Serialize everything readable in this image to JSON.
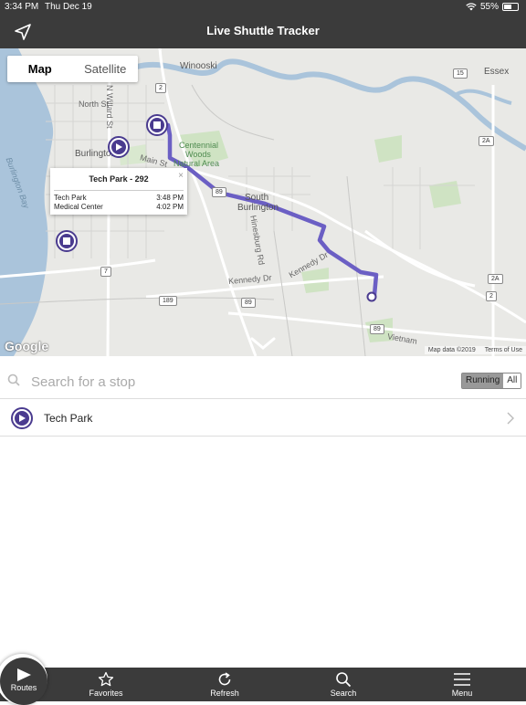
{
  "status": {
    "time": "3:34 PM",
    "date": "Thu Dec 19",
    "battery": "55%",
    "battery_level": 0.55
  },
  "header": {
    "title": "Live Shuttle Tracker",
    "left_icon": "location-arrow-icon"
  },
  "map": {
    "toggle": {
      "map_label": "Map",
      "satellite_label": "Satellite",
      "selected": "Map"
    },
    "labels": {
      "winooski": "Winooski",
      "essex": "Essex",
      "burlington": "Burlington",
      "burlington_bay": "Burlington Bay",
      "centennial": "Centennial",
      "woods": "Woods",
      "natural_area": "Natural Area",
      "south": "South",
      "burlington2": "Burlington",
      "n_willard": "N Willard St",
      "north_st": "North St",
      "main_st": "Main St",
      "kennedy_dr": "Kennedy Dr",
      "kennedy_dr2": "Kennedy Dr",
      "hinesburg": "Hinesburg Rd",
      "vietnam": "Vietnam"
    },
    "shields": {
      "r2": "2",
      "r15": "15",
      "r2a": "2A",
      "r2a_b": "2A",
      "r2_b": "2",
      "r7": "7",
      "r189": "189",
      "r89": "89",
      "r89_b": "89",
      "r89_c": "89"
    },
    "popup": {
      "title": "Tech Park - 292",
      "close": "×",
      "stops": [
        {
          "name": "Tech Park",
          "time": "3:48 PM"
        },
        {
          "name": "Medical Center",
          "time": "4:02 PM"
        }
      ]
    },
    "google": "Google",
    "attribution": "Map data ©2019",
    "terms": "Terms of Use",
    "route_color": "#6b5fc4",
    "marker_color": "#4a3b8f"
  },
  "search": {
    "placeholder": "Search for a stop",
    "filter": {
      "running": "Running",
      "all": "All",
      "selected": "Running"
    }
  },
  "routes": [
    {
      "label": "Tech Park",
      "icon": "play-marker-icon"
    }
  ],
  "tabbar": {
    "routes": "Routes",
    "favorites": "Favorites",
    "refresh": "Refresh",
    "search": "Search",
    "menu": "Menu",
    "selected": "Routes"
  }
}
